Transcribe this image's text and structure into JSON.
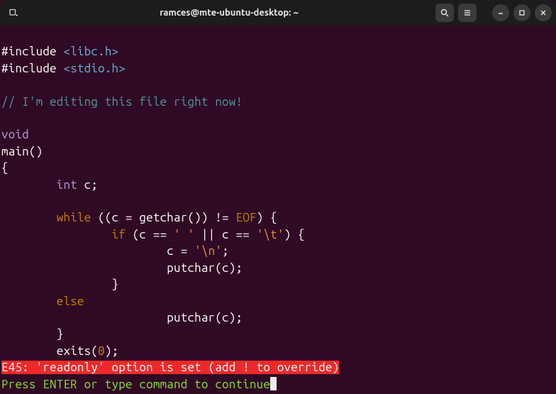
{
  "window": {
    "title": "ramces@mte-ubuntu-desktop: ~"
  },
  "code": {
    "line1_hash": "#include",
    "line1_hdr": "<libc.h>",
    "line2_hash": "#include",
    "line2_hdr": "<stdio.h>",
    "comment": "// I'm editing this file right now!",
    "void": "void",
    "main": "main",
    "main_paren": "()",
    "brace_open": "{",
    "decl_type": "int",
    "decl_rest": " c;",
    "while_kw": "while",
    "while_cond1": " ((c = getchar()) != ",
    "eof": "EOF",
    "while_cond2": ") {",
    "if_kw": "if",
    "if_cond1": " (c == ",
    "sp_char": "' '",
    "if_cond2": " || c == ",
    "tab_char": "'\\t'",
    "if_cond3": ") {",
    "assign1": "c = ",
    "nl_char": "'\\n'",
    "assign2": ";",
    "putchar1": "putchar(c);",
    "if_close": "}",
    "else_kw": "else",
    "putchar2": "putchar(c);",
    "while_close": "}",
    "exits_fn": "exits",
    "exits_open": "(",
    "zero": "0",
    "exits_close": ");"
  },
  "status": {
    "error": "E45: 'readonly' option is set (add ! to override)",
    "prompt": "Press ENTER or type command to continue"
  }
}
